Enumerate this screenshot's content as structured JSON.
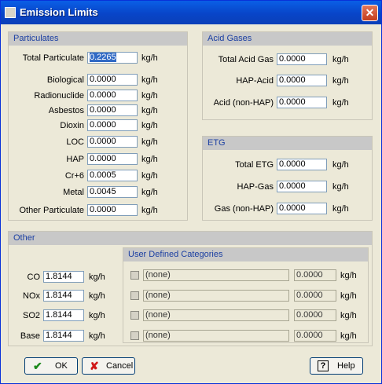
{
  "window": {
    "title": "Emission Limits",
    "close_glyph": "✕"
  },
  "particulates": {
    "header": "Particulates",
    "unit": "kg/h",
    "rows": [
      {
        "label": "Total Particulate",
        "value": "0.2265"
      },
      {
        "label": "Biological",
        "value": "0.0000"
      },
      {
        "label": "Radionuclide",
        "value": "0.0000"
      },
      {
        "label": "Asbestos",
        "value": "0.0000"
      },
      {
        "label": "Dioxin",
        "value": "0.0000"
      },
      {
        "label": "LOC",
        "value": "0.0000"
      },
      {
        "label": "HAP",
        "value": "0.0000"
      },
      {
        "label": "Cr+6",
        "value": "0.0005"
      },
      {
        "label": "Metal",
        "value": "0.0045"
      },
      {
        "label": "Other Particulate",
        "value": "0.0000"
      }
    ]
  },
  "acid_gases": {
    "header": "Acid Gases",
    "unit": "kg/h",
    "rows": [
      {
        "label": "Total Acid Gas",
        "value": "0.0000"
      },
      {
        "label": "HAP-Acid",
        "value": "0.0000"
      },
      {
        "label": "Acid (non-HAP)",
        "value": "0.0000"
      }
    ]
  },
  "etg": {
    "header": "ETG",
    "unit": "kg/h",
    "rows": [
      {
        "label": "Total ETG",
        "value": "0.0000"
      },
      {
        "label": "HAP-Gas",
        "value": "0.0000"
      },
      {
        "label": "Gas (non-HAP)",
        "value": "0.0000"
      }
    ]
  },
  "other": {
    "header": "Other",
    "unit": "kg/h",
    "rows": [
      {
        "label": "CO",
        "value": "1.8144"
      },
      {
        "label": "NOx",
        "value": "1.8144"
      },
      {
        "label": "SO2",
        "value": "1.8144"
      },
      {
        "label": "Base",
        "value": "1.8144"
      }
    ]
  },
  "user_defined": {
    "header": "User Defined Categories",
    "unit": "kg/h",
    "rows": [
      {
        "name": "(none)",
        "value": "0.0000"
      },
      {
        "name": "(none)",
        "value": "0.0000"
      },
      {
        "name": "(none)",
        "value": "0.0000"
      },
      {
        "name": "(none)",
        "value": "0.0000"
      }
    ]
  },
  "buttons": {
    "ok": "OK",
    "ok_icon": "✔",
    "cancel": "Cancel",
    "cancel_icon": "✘",
    "help": "Help",
    "help_icon": "?"
  },
  "colors": {
    "title_bar": "#0a5fe6",
    "group_header_text": "#1b3fa2",
    "selection": "#316ac5"
  }
}
